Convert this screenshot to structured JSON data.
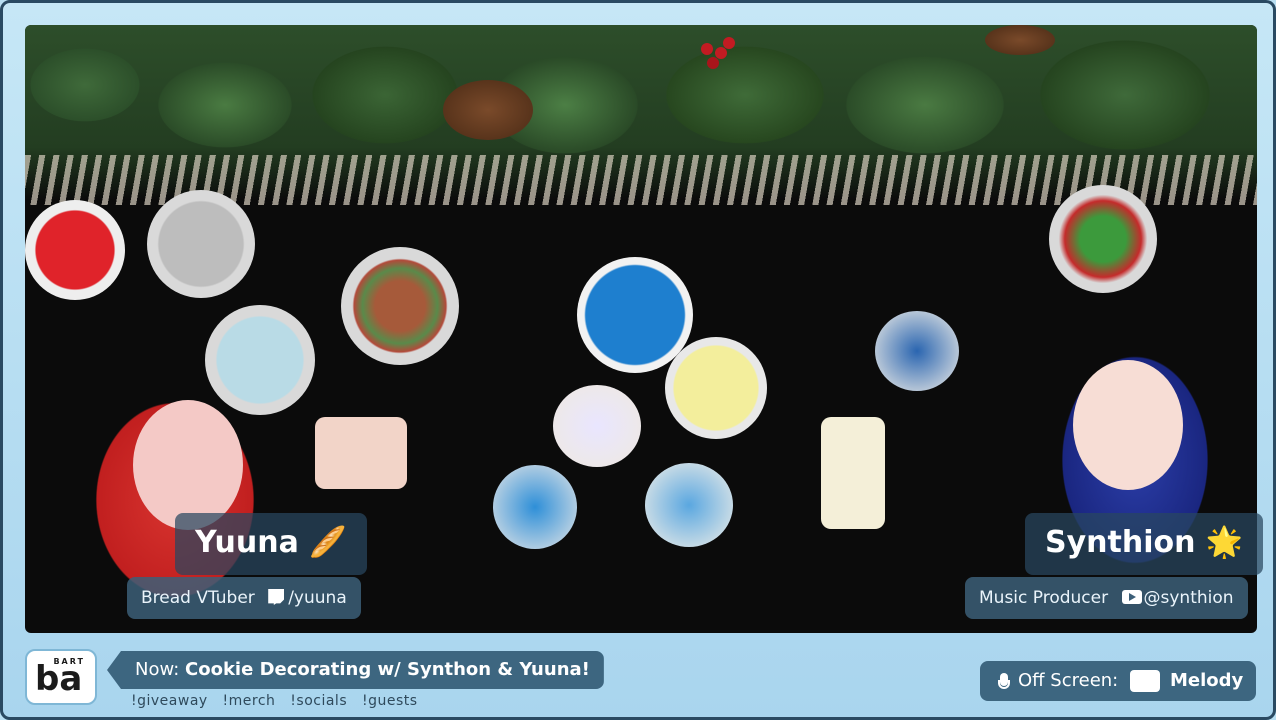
{
  "left_host": {
    "name": "Yuuna",
    "name_emoji": "🥖",
    "role": "Bread VTuber",
    "social_icon": "twitch-icon",
    "handle": "/yuuna"
  },
  "right_host": {
    "name": "Synthion",
    "name_emoji": "🌟",
    "role": "Music Producer",
    "social_icon": "youtube-icon",
    "handle": "@synthion"
  },
  "brand": {
    "logo_text": "ba",
    "logo_small": "BART"
  },
  "now_playing": {
    "prefix": "Now:",
    "title": "Cookie Decorating w/ Synthon & Yuuna!"
  },
  "commands": [
    "!giveaway",
    "!merch",
    "!socials",
    "!guests"
  ],
  "off_screen": {
    "label": "Off Screen:",
    "name": "Melody",
    "icon": "microphone-icon"
  },
  "colors": {
    "bar": "#3d6680",
    "frame": "#b9dff2",
    "accent": "#7fb7d6"
  }
}
